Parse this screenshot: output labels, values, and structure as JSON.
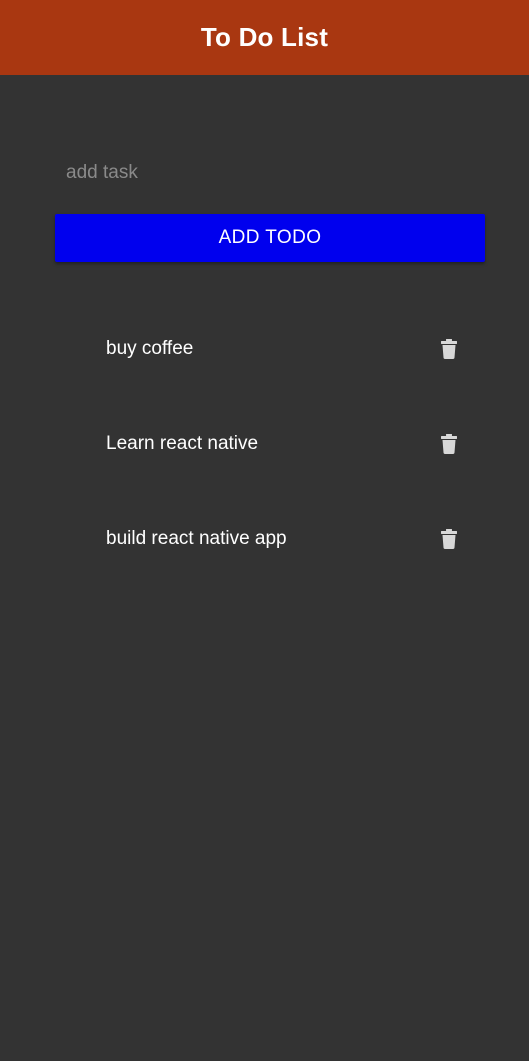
{
  "header": {
    "title": "To Do List"
  },
  "input": {
    "placeholder": "add task",
    "value": ""
  },
  "add_button": {
    "label": "ADD TODO"
  },
  "todos": [
    {
      "text": "buy coffee",
      "delete_icon": "trash-icon"
    },
    {
      "text": "Learn react native",
      "delete_icon": "trash-icon"
    },
    {
      "text": "build react native app",
      "delete_icon": "trash-icon"
    }
  ],
  "colors": {
    "header_bg": "#a93711",
    "page_bg": "#333333",
    "button_bg": "#0000ee",
    "icon": "#d8d8d8"
  }
}
